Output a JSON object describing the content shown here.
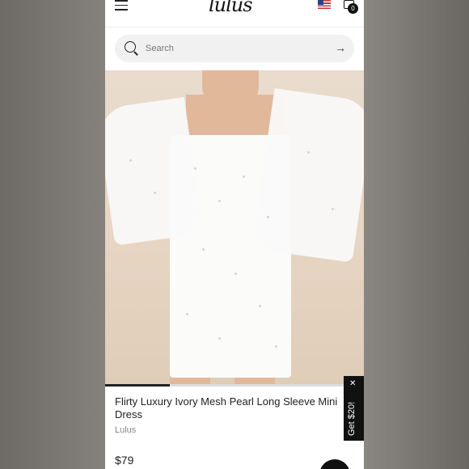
{
  "header": {
    "logo_text": "lulus",
    "cart_count": "0",
    "menu_icon": "hamburger-icon",
    "flag_icon": "us-flag-icon",
    "cart_icon": "shopping-bag-icon"
  },
  "search": {
    "placeholder": "Search",
    "value": "",
    "icon": "search-icon",
    "submit_icon": "arrow-right-icon"
  },
  "product": {
    "title": "Flirty Luxury Ivory Mesh Pearl Long Sleeve Mini Dress",
    "brand": "Lulus",
    "price": "$79",
    "image_progress": 0.25
  },
  "promo": {
    "text": "Get $20!",
    "close_icon": "close-icon"
  },
  "colors": {
    "background": "#7d7a77",
    "text": "#222222",
    "muted": "#888888",
    "promo_bg": "#111111"
  }
}
